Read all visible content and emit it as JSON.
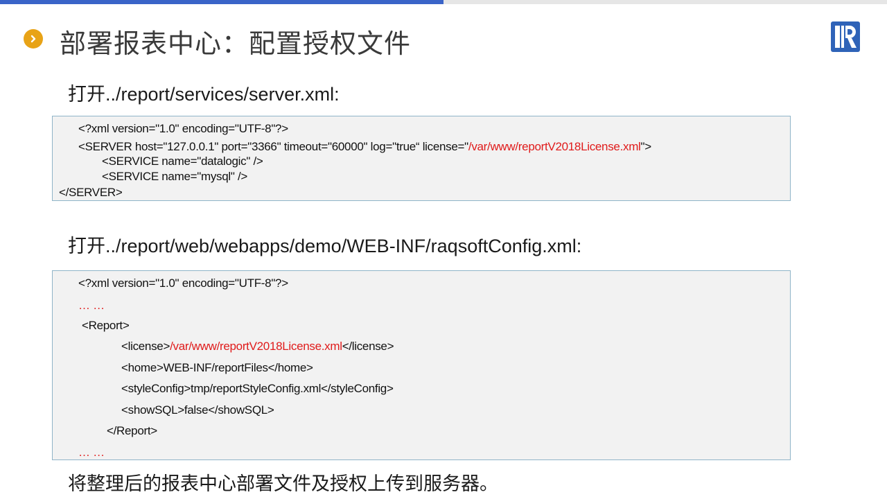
{
  "slide": {
    "progress_fraction": 0.5,
    "title": "部署报表中心：配置授权文件",
    "footer": "将整理后的报表中心部署文件及授权上传到服务器。"
  },
  "section1": {
    "path": "打开../report/services/server.xml:",
    "lines": {
      "l1": "<?xml version=\"1.0\" encoding=\"UTF-8\"?>",
      "l2_a": "<SERVER host=\"127.0.0.1\" port=\"3366\" timeout=\"60000\" log=\"true“ license=\"",
      "l2_red": "/var/www/reportV2018License.xml",
      "l2_b": "\">",
      "l3": "<SERVICE name=\"datalogic\" />",
      "l4": "<SERVICE name=\"mysql\" />",
      "l5": "</SERVER>"
    }
  },
  "section2": {
    "path": "打开../report/web/webapps/demo/WEB-INF/raqsoftConfig.xml:",
    "lines": {
      "l1": "<?xml version=\"1.0\" encoding=\"UTF-8\"?>",
      "l2_red": "… …",
      "l3": "<Report>",
      "l4_a": "<license>",
      "l4_red": "/var/www/reportV2018License.xml",
      "l4_b": "</license>",
      "l5": "<home>WEB-INF/reportFiles</home>",
      "l6": "<styleConfig>tmp/reportStyleConfig.xml</styleConfig>",
      "l7": "<showSQL>false</showSQL>",
      "l8": "</Report>",
      "l9_red": "… …"
    }
  },
  "colors": {
    "accent_blue": "#3a64c8",
    "chevron_orange": "#e8a317",
    "highlight_red": "#e01b1b",
    "logo_blue": "#2f63b8"
  },
  "icons": {
    "chevron": "chevron-right-icon",
    "logo": "raqsoft-logo-icon"
  }
}
